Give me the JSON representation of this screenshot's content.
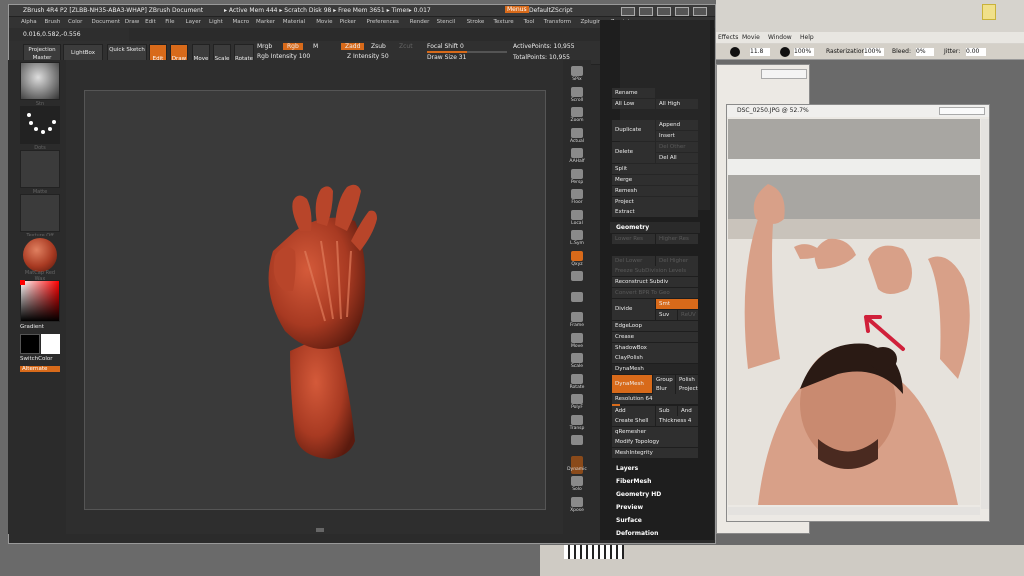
{
  "zbrush": {
    "title_left": "ZBrush 4R4 P2 [ZLBB-NH35-ABA3-WHAP]  ZBrush Document",
    "title_mid": "▸ Active Mem 444  ▸ Scratch Disk 98  ▸ Free Mem 3651  ▸ Timer▸ 0.017",
    "menus_badge": "Menus",
    "default_script": "DefaultZScript",
    "menu": [
      "Alpha",
      "Brush",
      "Color",
      "Document",
      "Draw",
      "Edit",
      "File",
      "Layer",
      "Light",
      "Macro",
      "Marker",
      "Material",
      "Movie",
      "Picker",
      "Preferences",
      "Render",
      "Stencil",
      "Stroke",
      "Texture",
      "Tool",
      "Transform",
      "Zplugin",
      "Zscript"
    ],
    "coords": "0.016,0.582,-0.556",
    "toolbar": {
      "projection_master": "Projection Master",
      "lightbox": "LightBox",
      "quick_sketch": "Quick Sketch",
      "edit": "Edit",
      "draw": "Draw",
      "move": "Move",
      "scale": "Scale",
      "rotate": "Rotate",
      "mrgb": "Mrgb",
      "rgb": "Rgb",
      "m": "M",
      "rgb_intensity": "Rgb Intensity 100",
      "zadd": "Zadd",
      "zsub": "Zsub",
      "zcut": "Zcut",
      "z_intensity": "Z Intensity 50",
      "focal_shift": "Focal Shift 0",
      "draw_size": "Draw Size 31",
      "active_points": "ActivePoints: 10,955",
      "total_points": "TotalPoints: 10,955"
    },
    "left_shelf": {
      "caps": [
        "Stn",
        "Dots",
        "Matte",
        "Texture Off",
        "MatCap Red Wax"
      ],
      "gradient": "Gradient",
      "switch_color": "SwitchColor",
      "alternate": "Alternate"
    },
    "right_shelf": [
      "SPix",
      "Scroll",
      "Zoom",
      "Actual",
      "AAHalf",
      "Persp",
      "Floor",
      "Local",
      "L.Sym",
      "Qxyz",
      "",
      "",
      "Frame",
      "Move",
      "Scale",
      "Rotate",
      "PolyF",
      "Transp",
      "",
      "Dynamic",
      "Solo",
      "Xpose"
    ],
    "palette": {
      "rename": "Rename",
      "append": "Append",
      "all_low": "All Low",
      "all_high": "All High",
      "duplicate": "Duplicate",
      "insert": "Insert",
      "delete": "Delete",
      "del_other": "Del Other",
      "del_all": "Del All",
      "split": "Split",
      "merge": "Merge",
      "remesh": "Remesh",
      "project": "Project",
      "extract": "Extract",
      "geometry": "Geometry",
      "lower_res": "Lower Res",
      "higher_res": "Higher Res",
      "del_lower": "Del Lower",
      "del_higher": "Del Higher",
      "freeze_subdiv": "Freeze SubDivision Levels",
      "reconstruct_subdiv": "Reconstruct Subdiv",
      "convert_bpr": "Convert BPR To Geo",
      "divide": "Divide",
      "smt": "Smt",
      "suv": "Suv",
      "rsmt": "ReUV",
      "edgeloop": "EdgeLoop",
      "crease": "Crease",
      "shadowbox": "ShadowBox",
      "claypolish": "ClayPolish",
      "dynamesh_hdr": "DynaMesh",
      "dynamesh": "DynaMesh",
      "group": "Group",
      "polish": "Polish",
      "blur": "Blur",
      "project2": "Project",
      "resolution": "Resolution 64",
      "add": "Add",
      "sub": "Sub",
      "and": "And",
      "create_shell": "Create Shell",
      "thickness": "Thickness 4",
      "qremesher": "qRemesher",
      "modify_topology": "Modify Topology",
      "meshintegrity": "MeshIntegrity",
      "sections": [
        "Layers",
        "FiberMesh",
        "Geometry HD",
        "Preview",
        "Surface",
        "Deformation"
      ]
    }
  },
  "photoshop": {
    "menu": [
      "Effects",
      "Movie",
      "Window",
      "Help"
    ],
    "size": "11.8",
    "opacity": "100%",
    "rasterization": "Rasterization:",
    "rast_val": "100%",
    "bleed": "Bleed:",
    "bleed_val": "0%",
    "jitter": "Jitter:",
    "jitter_val": "0.00",
    "doc_title": "DSC_0250.JPG @ 52.7%"
  },
  "colors": {
    "accent": "#d86a1a",
    "clay": "#a83a22",
    "arrow": "#d0203a"
  }
}
